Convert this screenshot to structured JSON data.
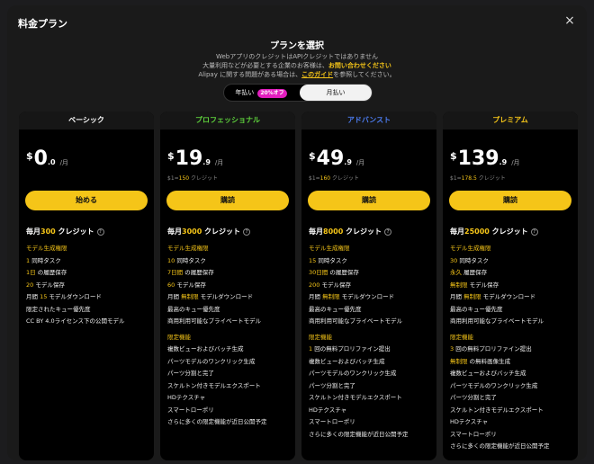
{
  "modal": {
    "title": "料金プラン",
    "close": "×"
  },
  "header": {
    "title": "プランを選択",
    "line1": "WebアプリのクレジットはAPIクレジットではありません",
    "line2_pre": "大量利用などが必要とする企業のお客様は、",
    "line2_link": "お問い合わせください",
    "line3_pre": "Alipay に関する問題がある場合は、",
    "line3_link": "このガイド",
    "line3_post": "を参照してください。"
  },
  "billing": {
    "yearly": "年払い",
    "badge": "20%オフ",
    "monthly": "月払い"
  },
  "cards": [
    {
      "name": "ベーシック",
      "name_color": "#ffffff",
      "currency": "$",
      "price_int": "0",
      "price_dec": ".0",
      "per": "/月",
      "credit_pre": "",
      "credit_hl": "",
      "credit_post": "",
      "button": "始める",
      "monthly_pre": "毎月",
      "monthly_hl": "300",
      "monthly_post": " クレジット",
      "features": [
        {
          "t": "モデル生成権限",
          "k": "sec"
        },
        {
          "h": "1",
          "t": " 同時タスク"
        },
        {
          "h": "1日",
          "t": " の履歴保存"
        },
        {
          "h": "20",
          "t": " モデル保存"
        },
        {
          "p": "月間 ",
          "h": "15",
          "t": " モデルダウンロード"
        },
        {
          "t": "限定されたキュー優先度"
        },
        {
          "t": "CC BY 4.0ライセンス下の公開モデル"
        }
      ]
    },
    {
      "name": "プロフェッショナル",
      "name_color": "#5ed13c",
      "currency": "$",
      "price_int": "19",
      "price_dec": ".9",
      "per": "/月",
      "credit_pre": "$1=",
      "credit_hl": "150",
      "credit_post": " クレジット",
      "button": "購読",
      "monthly_pre": "毎月",
      "monthly_hl": "3000",
      "monthly_post": " クレジット",
      "features": [
        {
          "t": "モデル生成権限",
          "k": "sec"
        },
        {
          "h": "10",
          "t": " 同時タスク"
        },
        {
          "h": "7日間",
          "t": " の履歴保存"
        },
        {
          "h": "60",
          "t": " モデル保存"
        },
        {
          "p": "月間 ",
          "h": "無制限",
          "t": " モデルダウンロード"
        },
        {
          "t": "最高のキュー優先度"
        },
        {
          "t": "商用利用可能なプライベートモデル"
        },
        {
          "t": "限定機能",
          "k": "sec gap"
        },
        {
          "t": "複数ビューおよびバッチ生成"
        },
        {
          "t": "パーツモデルのワンクリック生成"
        },
        {
          "t": "パーツ分割と完了"
        },
        {
          "t": "スケルトン付きモデルエクスポート"
        },
        {
          "t": "HDテクスチャ"
        },
        {
          "t": "スマートローポリ"
        },
        {
          "t": "さらに多くの限定機能が近日公開予定"
        }
      ]
    },
    {
      "name": "アドバンスト",
      "name_color": "#4c7cf0",
      "currency": "$",
      "price_int": "49",
      "price_dec": ".9",
      "per": "/月",
      "credit_pre": "$1=",
      "credit_hl": "160",
      "credit_post": " クレジット",
      "button": "購読",
      "monthly_pre": "毎月",
      "monthly_hl": "8000",
      "monthly_post": " クレジット",
      "features": [
        {
          "t": "モデル生成権限",
          "k": "sec"
        },
        {
          "h": "15",
          "t": " 同時タスク"
        },
        {
          "h": "30日間",
          "t": " の履歴保存"
        },
        {
          "h": "200",
          "t": " モデル保存"
        },
        {
          "p": "月間 ",
          "h": "無制限",
          "t": " モデルダウンロード"
        },
        {
          "t": "最高のキュー優先度"
        },
        {
          "t": "商用利用可能なプライベートモデル"
        },
        {
          "t": "限定機能",
          "k": "sec gap"
        },
        {
          "h": "1",
          "t": " 回の無料プロリファイン提出"
        },
        {
          "t": "複数ビューおよびバッチ生成"
        },
        {
          "t": "パーツモデルのワンクリック生成"
        },
        {
          "t": "パーツ分割と完了"
        },
        {
          "t": "スケルトン付きモデルエクスポート"
        },
        {
          "t": "HDテクスチャ"
        },
        {
          "t": "スマートローポリ"
        },
        {
          "t": "さらに多くの限定機能が近日公開予定"
        }
      ]
    },
    {
      "name": "プレミアム",
      "name_color": "#f5c518",
      "currency": "$",
      "price_int": "139",
      "price_dec": ".9",
      "per": "/月",
      "credit_pre": "$1=",
      "credit_hl": "178.5",
      "credit_post": " クレジット",
      "button": "購読",
      "monthly_pre": "毎月",
      "monthly_hl": "25000",
      "monthly_post": " クレジット",
      "features": [
        {
          "t": "モデル生成権限",
          "k": "sec"
        },
        {
          "h": "30",
          "t": " 同時タスク"
        },
        {
          "h": "永久",
          "t": " 履歴保存"
        },
        {
          "h": "無制限",
          "t": " モデル保存"
        },
        {
          "p": "月間 ",
          "h": "無制限",
          "t": " モデルダウンロード"
        },
        {
          "t": "最高のキュー優先度"
        },
        {
          "t": "商用利用可能なプライベートモデル"
        },
        {
          "t": "限定機能",
          "k": "sec gap"
        },
        {
          "h": "3",
          "t": " 回の無料プロリファイン提出"
        },
        {
          "h": "無制限",
          "t": " の無料画像生成"
        },
        {
          "t": "複数ビューおよびバッチ生成"
        },
        {
          "t": "パーツモデルのワンクリック生成"
        },
        {
          "t": "パーツ分割と完了"
        },
        {
          "t": "スケルトン付きモデルエクスポート"
        },
        {
          "t": "HDテクスチャ"
        },
        {
          "t": "スマートローポリ"
        },
        {
          "t": "さらに多くの限定機能が近日公開予定"
        }
      ]
    }
  ]
}
